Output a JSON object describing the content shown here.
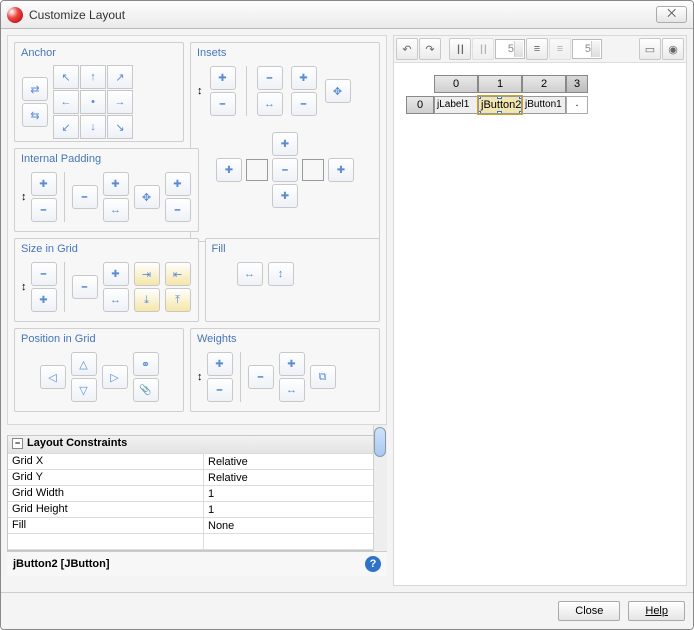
{
  "window": {
    "title": "Customize Layout",
    "close_glyph": "⨉"
  },
  "groups": {
    "anchor": "Anchor",
    "internal_padding": "Internal Padding",
    "size_in_grid": "Size in Grid",
    "insets": "Insets",
    "fill": "Fill",
    "weights": "Weights",
    "position_in_grid": "Position in Grid"
  },
  "anchor_cells": [
    "↖",
    "↑",
    "↗",
    "←",
    "•",
    "→",
    "↙",
    "↓",
    "↘"
  ],
  "props": {
    "header": "Layout Constraints",
    "rows": [
      {
        "name": "Grid X",
        "value": "Relative"
      },
      {
        "name": "Grid Y",
        "value": "Relative"
      },
      {
        "name": "Grid Width",
        "value": "1"
      },
      {
        "name": "Grid Height",
        "value": "1"
      },
      {
        "name": "Fill",
        "value": "None"
      }
    ]
  },
  "status": {
    "text": "jButton2 [JButton]"
  },
  "toolbar": {
    "spin1": "5",
    "spin2": "5"
  },
  "grid": {
    "col_headers": [
      "0",
      "1",
      "2",
      "3"
    ],
    "row_header": "0",
    "cells": [
      "jLabel1",
      "jButton2",
      "jButton1",
      "."
    ]
  },
  "footer": {
    "close": "Close",
    "help": "Help"
  }
}
